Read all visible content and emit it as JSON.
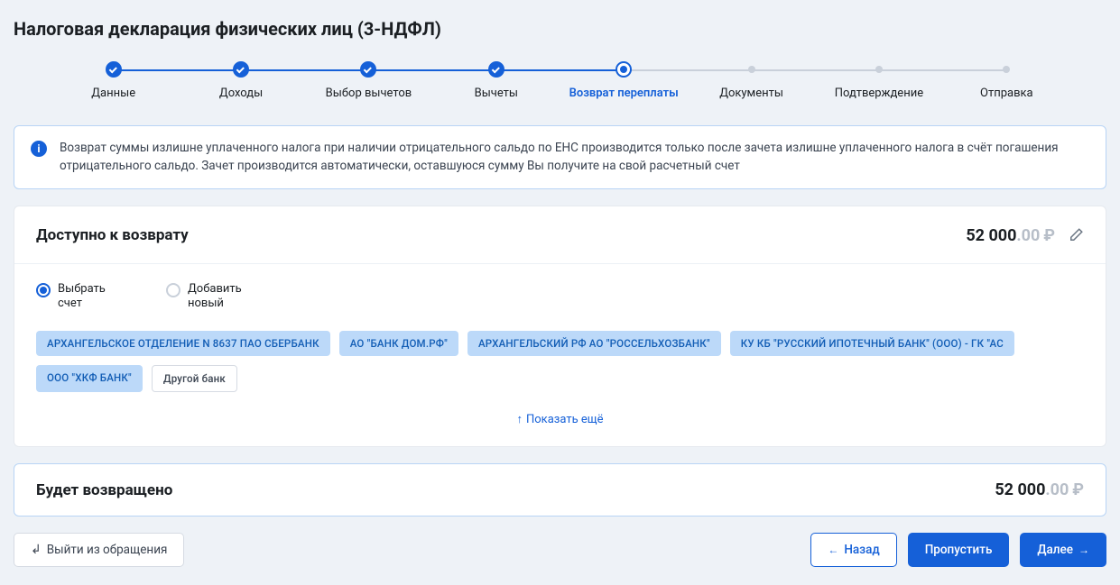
{
  "page_title": "Налоговая декларация физических лиц (3-НДФЛ)",
  "stepper": [
    {
      "label": "Данные",
      "state": "done"
    },
    {
      "label": "Доходы",
      "state": "done"
    },
    {
      "label": "Выбор вычетов",
      "state": "done"
    },
    {
      "label": "Вычеты",
      "state": "done"
    },
    {
      "label": "Возврат переплаты",
      "state": "current"
    },
    {
      "label": "Документы",
      "state": "future"
    },
    {
      "label": "Подтверждение",
      "state": "future"
    },
    {
      "label": "Отправка",
      "state": "future"
    }
  ],
  "info_text": "Возврат суммы излишне уплаченного налога при наличии отрицательного сальдо по ЕНС производится только после зачета излишне уплаченного налога в счёт погашения отрицательного сальдо. Зачет производится автоматически, оставшуюся сумму Вы получите на свой расчетный счет",
  "available": {
    "title": "Доступно к возврату",
    "amount_int": "52 000",
    "amount_dec": ".00",
    "currency": "₽"
  },
  "radios": {
    "select_account": "Выбрать счет",
    "add_new": "Добавить новый"
  },
  "banks": [
    "АРХАНГЕЛЬСКОЕ ОТДЕЛЕНИЕ N 8637 ПАО СБЕРБАНК",
    "АО \"БАНК ДОМ.РФ\"",
    "АРХАНГЕЛЬСКИЙ РФ АО \"РОССЕЛЬХОЗБАНК\"",
    "КУ КБ \"РУССКИЙ ИПОТЕЧНЫЙ БАНК\" (ООО) - ГК \"АС",
    "ООО \"ХКФ БАНК\""
  ],
  "other_bank_label": "Другой банк",
  "show_more": "Показать ещё",
  "returned": {
    "title": "Будет возвращено",
    "amount_int": "52 000",
    "amount_dec": ".00",
    "currency": "₽"
  },
  "footer": {
    "exit": "Выйти из обращения",
    "back": "Назад",
    "skip": "Пропустить",
    "next": "Далее"
  }
}
